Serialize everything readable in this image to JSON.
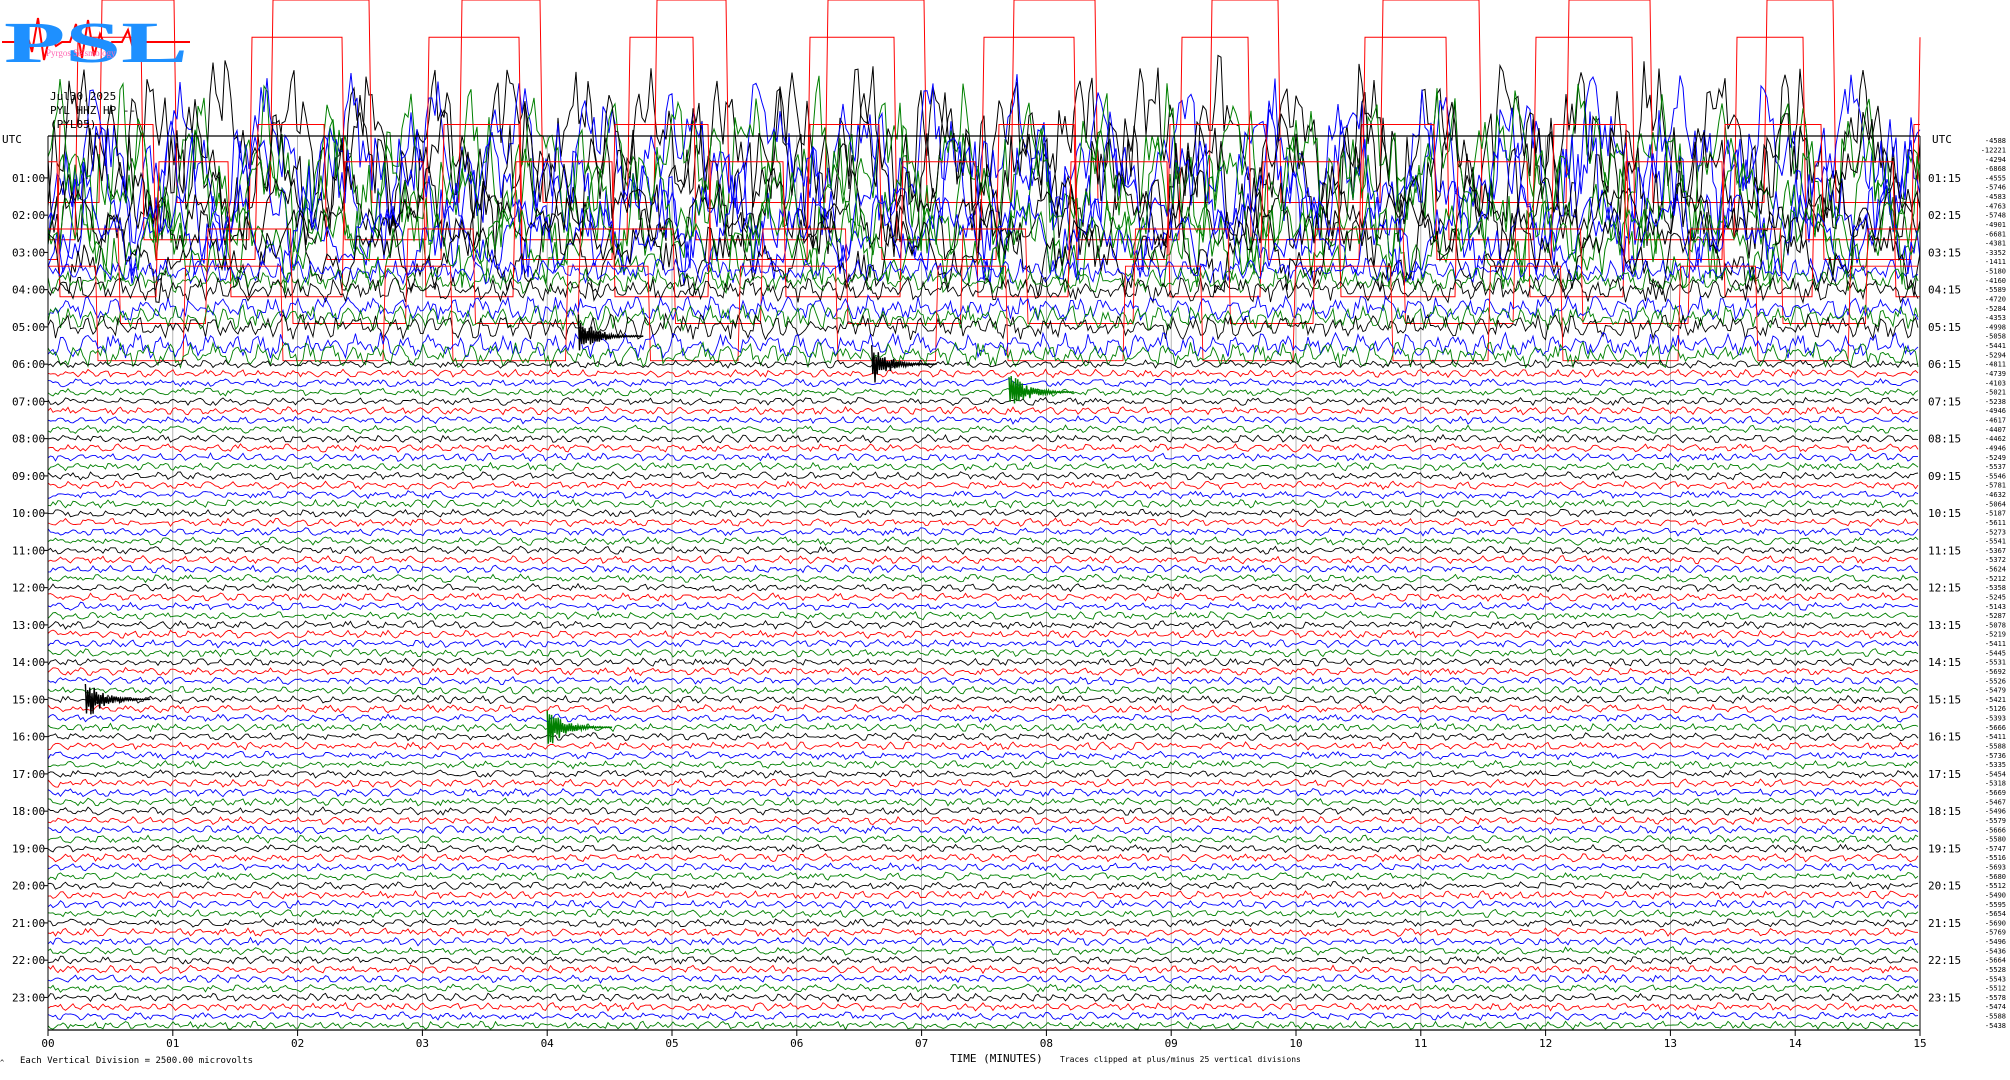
{
  "logo": {
    "text": "PSL",
    "tagline": "Pyrgos Seismology"
  },
  "header": {
    "date": "Jul30,2025",
    "channel": "PYL HHZ HP --",
    "station": "(PYL05)"
  },
  "axis": {
    "left_label": "UTC",
    "right_label": "UTC",
    "x_title": "TIME (MINUTES)",
    "scale_note": "Each Vertical Division = 2500.00 microvolts",
    "clip_note": "Traces clipped at plus/minus 25 vertical divisions",
    "corner_mark": "^"
  },
  "colors": {
    "black": "#000000",
    "red": "#ff0000",
    "blue": "#0000ff",
    "green": "#008000",
    "grid": "#a0a0a0"
  },
  "chart_data": {
    "type": "line",
    "title": "",
    "xlabel": "TIME (MINUTES)",
    "ylabel": "UTC",
    "x_ticks": [
      "00",
      "01",
      "02",
      "03",
      "04",
      "05",
      "06",
      "07",
      "08",
      "09",
      "10",
      "11",
      "12",
      "13",
      "14",
      "15"
    ],
    "xlim": [
      0,
      15
    ],
    "left_hour_labels": [
      "01:00",
      "02:00",
      "03:00",
      "04:00",
      "05:00",
      "06:00",
      "07:00",
      "08:00",
      "09:00",
      "10:00",
      "11:00",
      "12:00",
      "13:00",
      "14:00",
      "15:00",
      "16:00",
      "17:00",
      "18:00",
      "19:00",
      "20:00",
      "21:00",
      "22:00",
      "23:00"
    ],
    "right_hour_labels": [
      "01:15",
      "02:15",
      "03:15",
      "04:15",
      "05:15",
      "06:15",
      "07:15",
      "08:15",
      "09:15",
      "10:15",
      "11:15",
      "12:15",
      "13:15",
      "14:15",
      "15:15",
      "16:15",
      "17:15",
      "18:15",
      "19:15",
      "20:15",
      "21:15",
      "22:15",
      "23:15"
    ],
    "trace_offsets": [
      "-4588",
      "-12221",
      "-4294",
      "-6868",
      "-4555",
      "-5746",
      "-4583",
      "-4763",
      "-5748",
      "-4901",
      "-6681",
      "-4381",
      "-3352",
      "-1411",
      "-5180",
      "-4160",
      "-5589",
      "-4720",
      "-5284",
      "-4353",
      "-4998",
      "-5058",
      "-5441",
      "-5294",
      "-4811",
      "-4739",
      "-4103",
      "-5021",
      "-5238",
      "-4946",
      "-4617",
      "-4407",
      "-4462",
      "-4946",
      "-5249",
      "-5537",
      "-5546",
      "-5781",
      "-4632",
      "-5064",
      "-5187",
      "-5611",
      "-5273",
      "-5541",
      "-5367",
      "-5372",
      "-5624",
      "-5212",
      "-5358",
      "-5245",
      "-5143",
      "-5287",
      "-5078",
      "-5219",
      "-5411",
      "-5445",
      "-5531",
      "-5692",
      "-5526",
      "-5479",
      "-5421",
      "-5126",
      "-5393",
      "-5666",
      "-5411",
      "-5588",
      "-5736",
      "-5335",
      "-5454",
      "-5318",
      "-5669",
      "-5467",
      "-5496",
      "-5579",
      "-5666",
      "-5580",
      "-5747",
      "-5516",
      "-5693",
      "-5680",
      "-5512",
      "-5490",
      "-5595",
      "-5654",
      "-5690",
      "-5769",
      "-5496",
      "-5436",
      "-5664",
      "-5528",
      "-5543",
      "-5512",
      "-5578",
      "-5474",
      "-5588",
      "-5438"
    ],
    "trace_color_cycle": [
      "black",
      "red",
      "blue",
      "green"
    ],
    "events": [
      {
        "trace": 21,
        "minute": 4.25,
        "color": "black"
      },
      {
        "trace": 24,
        "minute": 6.6,
        "color": "black"
      },
      {
        "trace": 27,
        "minute": 7.7,
        "color": "green"
      },
      {
        "trace": 60,
        "minute": 0.3,
        "color": "black"
      },
      {
        "trace": 63,
        "minute": 4.0,
        "color": "green"
      }
    ]
  }
}
